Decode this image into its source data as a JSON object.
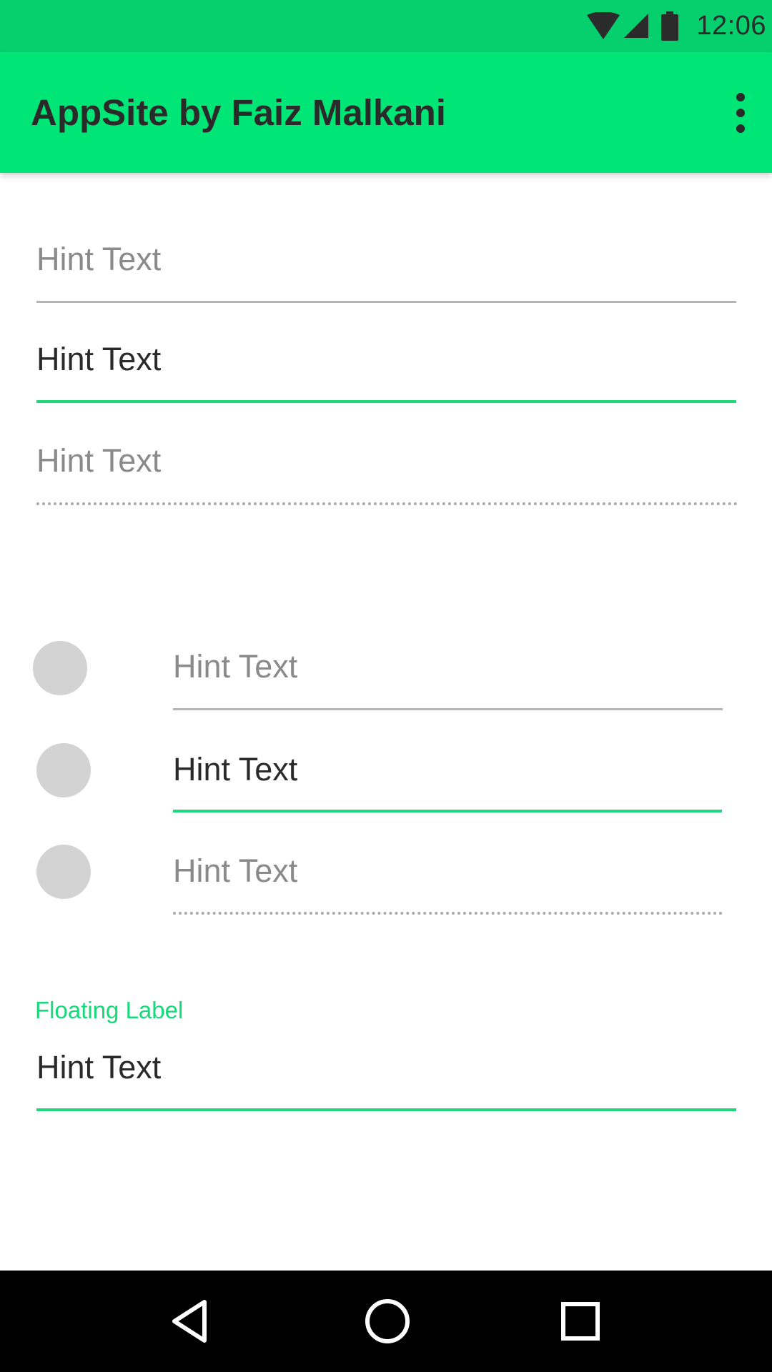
{
  "status_bar": {
    "time": "12:06",
    "icons": [
      "wifi-icon",
      "cell-signal-icon",
      "battery-icon"
    ],
    "color": "#06cf6e"
  },
  "app_bar": {
    "title": "AppSite by Faiz Malkani",
    "overflow_icon": "more-vert-icon",
    "color": "#00e676"
  },
  "fields": {
    "f1": {
      "text": "Hint Text",
      "state": "hint"
    },
    "f2": {
      "text": "Hint Text",
      "state": "focused"
    },
    "f3": {
      "text": "Hint Text",
      "state": "disabled"
    },
    "f4": {
      "text": "Hint Text",
      "state": "hint"
    },
    "f5": {
      "text": "Hint Text",
      "state": "focused"
    },
    "f6": {
      "text": "Hint Text",
      "state": "disabled"
    },
    "f7": {
      "text": "Hint Text",
      "state": "focused",
      "floating_label": "Floating Label"
    }
  },
  "colors": {
    "accent": "#1fd87b",
    "underline": "#b5b5b5",
    "avatar": "#d3d3d3",
    "hint": "#8a8a8a"
  },
  "nav_bar": {
    "buttons": [
      "back-icon",
      "home-icon",
      "recents-icon"
    ]
  }
}
